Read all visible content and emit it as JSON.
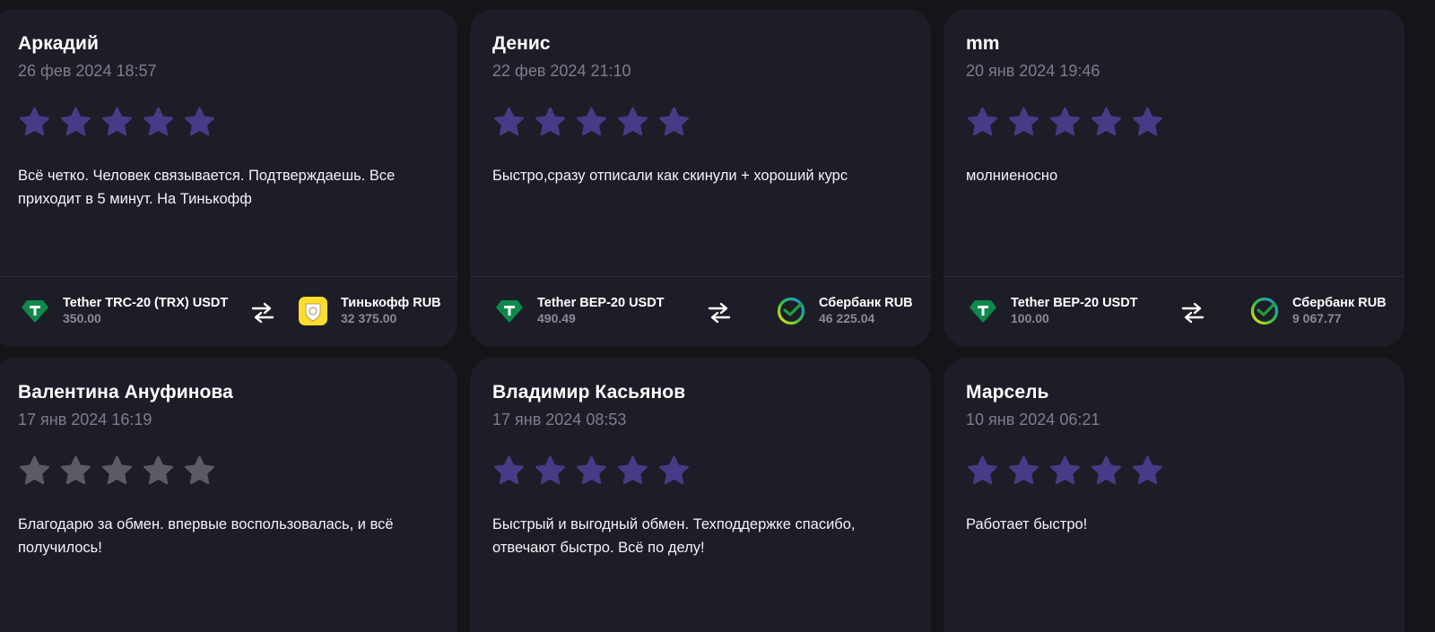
{
  "colors": {
    "star_active": "#463b86",
    "star_inactive": "#5b5b66",
    "card_bg": "#1d1d28",
    "page_bg": "#141419"
  },
  "reviews": [
    {
      "name": "Аркадий",
      "date": "26 фев 2024 18:57",
      "rating": 5,
      "star_state": "active",
      "text": "Всё четко. Человек связывается. Подтверждаешь. Все приходит в 5 минут. На Тинькофф",
      "from": {
        "name": "Tether TRC-20 (TRX) USDT",
        "amount": "350.00",
        "icon": "tether-icon"
      },
      "to": {
        "name": "Тинькофф RUB",
        "amount": "32 375.00",
        "icon": "tinkoff-icon"
      }
    },
    {
      "name": "Денис",
      "date": "22 фев 2024 21:10",
      "rating": 5,
      "star_state": "active",
      "text": "Быстро,сразу отписали как скинули + хороший курс",
      "from": {
        "name": "Tether BEP-20 USDT",
        "amount": "490.49",
        "icon": "tether-icon"
      },
      "to": {
        "name": "Сбербанк RUB",
        "amount": "46 225.04",
        "icon": "sberbank-icon"
      }
    },
    {
      "name": "mm",
      "date": "20 янв 2024 19:46",
      "rating": 5,
      "star_state": "active",
      "text": "молниеносно",
      "from": {
        "name": "Tether BEP-20 USDT",
        "amount": "100.00",
        "icon": "tether-icon"
      },
      "to": {
        "name": "Сбербанк RUB",
        "amount": "9 067.77",
        "icon": "sberbank-icon"
      }
    },
    {
      "name": "Валентина Ануфинова",
      "date": "17 янв 2024 16:19",
      "rating": 5,
      "star_state": "inactive",
      "text": "Благодарю за обмен. впервые воспользовалась, и всё получилось!"
    },
    {
      "name": "Владимир Касьянов",
      "date": "17 янв 2024 08:53",
      "rating": 5,
      "star_state": "active",
      "text": "Быстрый и выгодный обмен. Техподдержке спасибо, отвечают быстро. Всё по делу!"
    },
    {
      "name": "Марсель",
      "date": "10 янв 2024 06:21",
      "rating": 5,
      "star_state": "active",
      "text": "Работает быстро!"
    }
  ]
}
